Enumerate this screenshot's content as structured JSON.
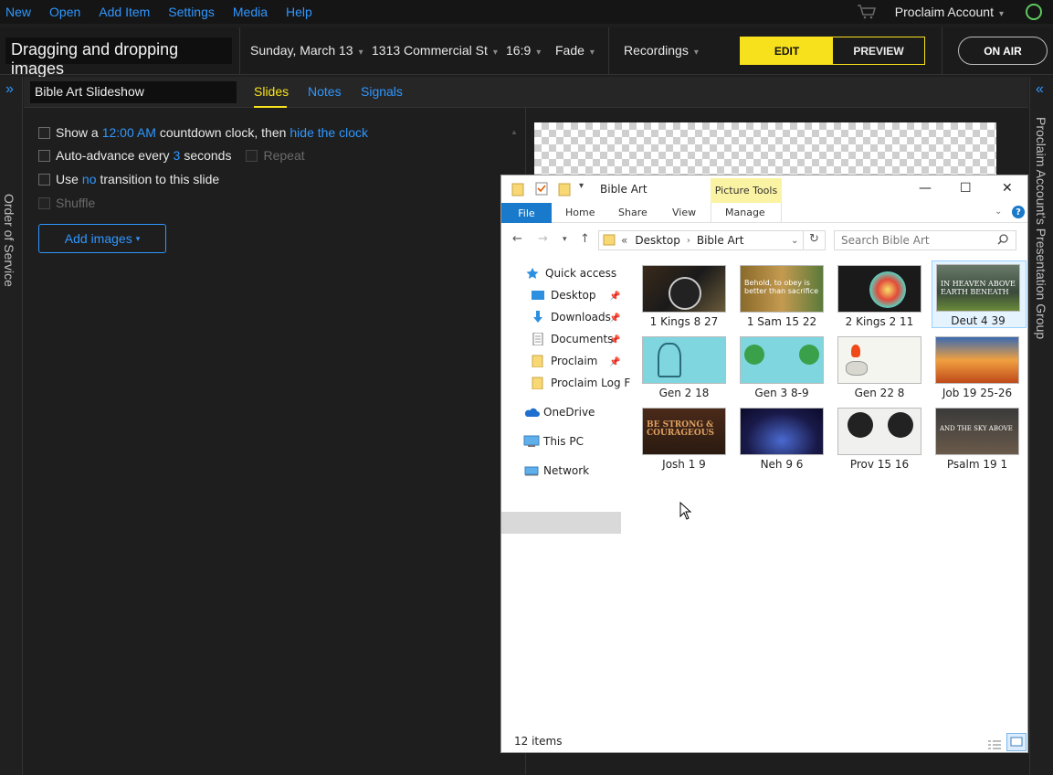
{
  "menu": {
    "items": [
      "New",
      "Open",
      "Add Item",
      "Settings",
      "Media",
      "Help"
    ],
    "account": "Proclaim Account"
  },
  "header": {
    "title": "Dragging and dropping images",
    "date": "Sunday, March 13",
    "location": "1313 Commercial St",
    "aspect": "16:9",
    "transition": "Fade",
    "recordings": "Recordings",
    "edit": "EDIT",
    "preview": "PREVIEW",
    "on_air": "ON AIR"
  },
  "sidebar": {
    "left_title": "Order of Service",
    "right_title": "Proclaim Account's Presentation Group"
  },
  "item": {
    "name": "Bible Art Slideshow",
    "tabs": [
      "Slides",
      "Notes",
      "Signals"
    ]
  },
  "options": {
    "row1": {
      "a": "Show a",
      "time": "12:00 AM",
      "b": "countdown clock, then",
      "link": "hide the clock"
    },
    "row2": {
      "a": "Auto-advance every",
      "num": "3",
      "b": "seconds",
      "repeat": "Repeat"
    },
    "row3": {
      "a": "Use",
      "link": "no",
      "b": "transition to this slide"
    },
    "row4": "Shuffle",
    "add_images": "Add images"
  },
  "explorer": {
    "title": "Bible Art",
    "picture_tools": "Picture Tools",
    "ribbon": [
      "File",
      "Home",
      "Share",
      "View",
      "Manage"
    ],
    "path": {
      "root": "Desktop",
      "folder": "Bible Art"
    },
    "search_placeholder": "Search Bible Art",
    "nav": [
      "Quick access",
      "Desktop",
      "Downloads",
      "Documents",
      "Proclaim",
      "Proclaim Log F",
      "OneDrive",
      "This PC",
      "Network"
    ],
    "files": [
      "1 Kings 8 27",
      "1 Sam 15 22",
      "2 Kings 2 11",
      "Deut 4 39",
      "Gen 2 18",
      "Gen 3 8-9",
      "Gen 22 8",
      "Job 19 25-26",
      "Josh 1 9",
      "Neh 9 6",
      "Prov 15 16",
      "Psalm 19 1"
    ],
    "thumb_text": {
      "sam": "Behold, to obey is better than sacrifice",
      "deut": "IN HEAVEN ABOVE EARTH BENEATH",
      "josh": "BE STRONG & COURAGEOUS",
      "psalm": "AND THE SKY ABOVE"
    },
    "status": "12 items"
  },
  "colors": {
    "accent": "#2f97ff",
    "highlight": "#f7e11c",
    "explorer_blue": "#1979ca"
  }
}
